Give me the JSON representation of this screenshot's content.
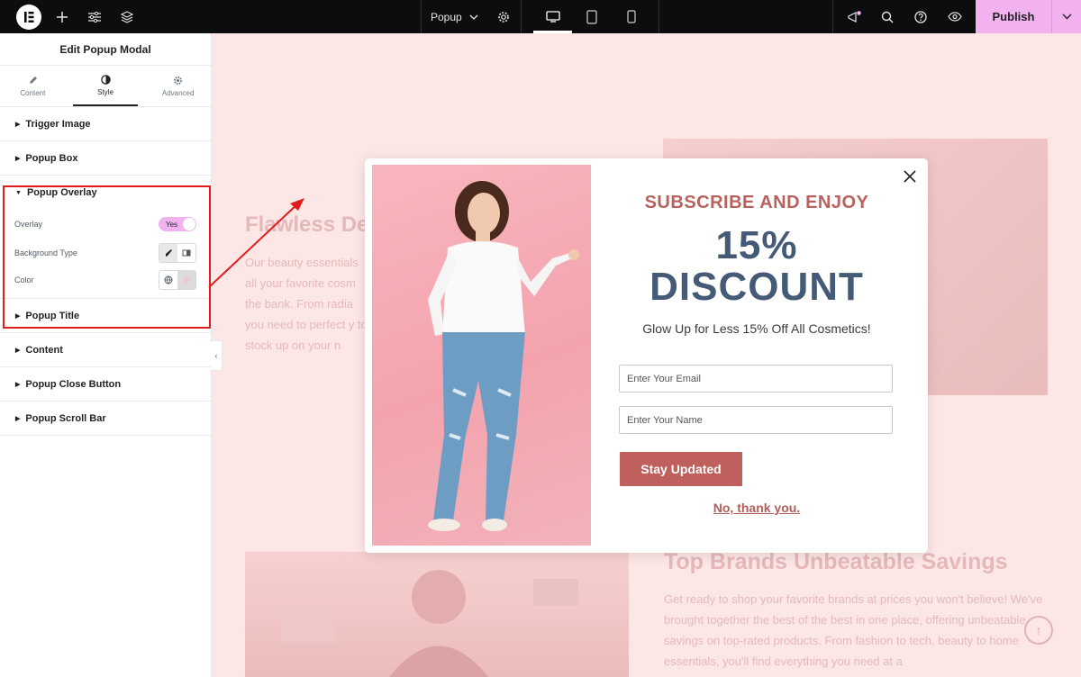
{
  "topbar": {
    "document_label": "Popup",
    "publish_label": "Publish"
  },
  "sidebar": {
    "title": "Edit Popup Modal",
    "tabs": [
      {
        "label": "Content"
      },
      {
        "label": "Style"
      },
      {
        "label": "Advanced"
      }
    ],
    "sections": {
      "trigger_image": "Trigger Image",
      "popup_box": "Popup Box",
      "popup_overlay": "Popup Overlay",
      "popup_title": "Popup Title",
      "content": "Content",
      "popup_close_button": "Popup Close Button",
      "popup_scroll_bar": "Popup Scroll Bar"
    },
    "controls": {
      "overlay_label": "Overlay",
      "overlay_value": "Yes",
      "background_type_label": "Background Type",
      "color_label": "Color"
    }
  },
  "canvas": {
    "heading_1": "Flawless De",
    "para_1": "Our beauty essentials all your favorite cosm the bank. From radia you need to perfect y to stock up on your n",
    "heading_2": "Top Brands Unbeatable Savings",
    "para_2": "Get ready to shop your favorite brands at prices you won't believe! We've brought together the best of the best in one place, offering unbeatable savings on top-rated products. From fashion to tech, beauty to home essentials, you'll find everything you need at a"
  },
  "popup": {
    "subscribe": "SUBSCRIBE AND ENJOY",
    "discount_line1": "15%",
    "discount_line2": "DISCOUNT",
    "glow": "Glow Up for Less 15% Off All Cosmetics!",
    "email_placeholder": "Enter Your Email",
    "name_placeholder": "Enter Your Name",
    "cta": "Stay Updated",
    "decline": "No, thank you."
  },
  "colors": {
    "publish": "#f1b2ef",
    "callout": "#e21c1c",
    "accent_red": "#c0605d",
    "discount_blue": "#445a76"
  }
}
